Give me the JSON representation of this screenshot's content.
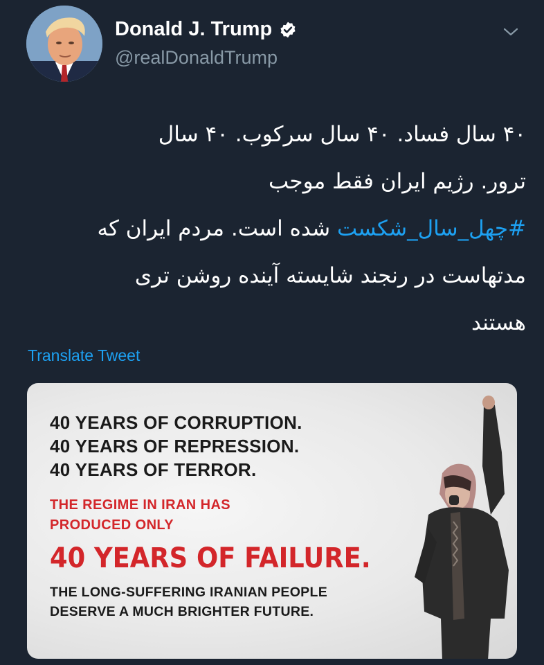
{
  "author": {
    "display_name": "Donald J. Trump",
    "handle": "@realDonaldTrump",
    "verified": true
  },
  "tweet": {
    "lines": [
      "۴۰ سال فساد. ۴۰ سال سرکوب. ۴۰ سال",
      "ترور. رژیم ایران فقط موجب",
      "",
      "مدتهاست در رنجند شایسته آینده روشن تری",
      "هستند"
    ],
    "hashtag": "#چهل_سال_شکست",
    "after_hashtag": " شده است. مردم ایران که",
    "translate_label": "Translate Tweet"
  },
  "media": {
    "line1": "40 YEARS OF CORRUPTION.",
    "line2": "40 YEARS OF REPRESSION.",
    "line3": "40 YEARS OF TERROR.",
    "red1": "THE REGIME IN IRAN HAS",
    "red2": "PRODUCED ONLY",
    "headline": "40 YEARS OF FAILURE.",
    "sub1": "THE LONG-SUFFERING IRANIAN PEOPLE",
    "sub2": "DESERVE A MUCH BRIGHTER FUTURE."
  },
  "colors": {
    "background": "#1b2431",
    "link": "#1da1f2",
    "handle": "#8899a6",
    "headline_red": "#d3262a"
  },
  "icons": {
    "verified": "verified-badge-icon",
    "menu": "chevron-down-icon"
  }
}
